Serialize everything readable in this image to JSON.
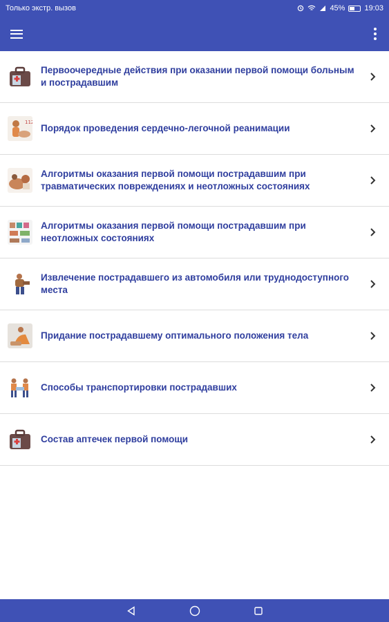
{
  "status_bar": {
    "carrier": "Только экстр. вызов",
    "battery": "45%",
    "time": "19:03"
  },
  "app_bar": {
    "menu_icon": "hamburger-menu-icon",
    "more_icon": "more-vert-icon"
  },
  "list": {
    "items": [
      {
        "title": "Первоочередные действия при оказании первой помощи больным и пострадавшим",
        "icon": "first-aid-kit-icon"
      },
      {
        "title": "Порядок проведения сердечно-легочной реанимации",
        "icon": "cpr-icon"
      },
      {
        "title": "Алгоритмы оказания первой помощи пострадавшим при травматических повреждениях и неотложных состояниях",
        "icon": "bandage-icon"
      },
      {
        "title": "Алгоритмы оказания первой помощи пострадавшим при неотложных состояниях",
        "icon": "emergency-icon"
      },
      {
        "title": "Извлечение пострадавшего из автомобиля или труднодоступного места",
        "icon": "rescue-icon"
      },
      {
        "title": "Придание пострадавшему оптимального положения тела",
        "icon": "recovery-position-icon"
      },
      {
        "title": "Способы транспортировки пострадавших",
        "icon": "transport-icon"
      },
      {
        "title": "Состав аптечек первой помощи",
        "icon": "first-aid-kit-icon"
      }
    ]
  },
  "colors": {
    "primary": "#3f51b5",
    "title_text": "#2f3e9e",
    "divider": "#dcdcdc"
  }
}
